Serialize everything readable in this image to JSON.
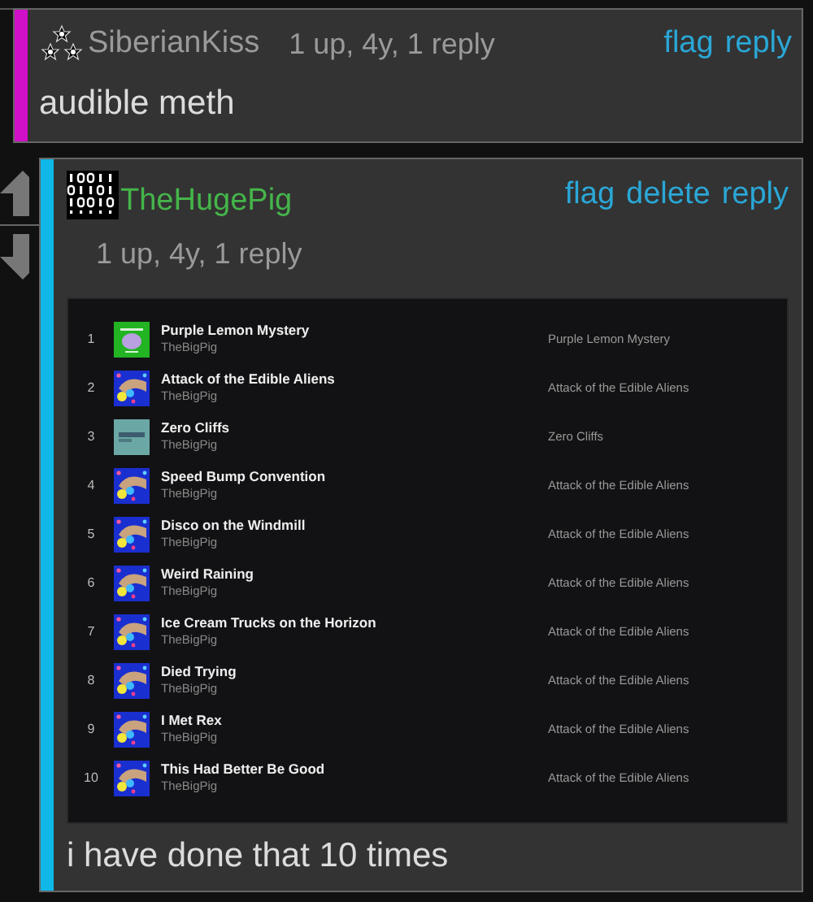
{
  "comment": {
    "author": "SiberianKiss",
    "meta": "1 up, 4y, 1 reply",
    "actions": [
      "flag",
      "reply"
    ],
    "text": "audible meth"
  },
  "reply": {
    "author": "TheHugePig",
    "meta": "1 up, 4y, 1 reply",
    "actions": [
      "flag",
      "delete",
      "reply"
    ],
    "text": "i have done that 10 times",
    "tracks": [
      {
        "number": "1",
        "title": "Purple Lemon Mystery",
        "artist": "TheBigPig",
        "album": "Purple Lemon Mystery",
        "kind": "planet"
      },
      {
        "number": "2",
        "title": "Attack of the Edible Aliens",
        "artist": "TheBigPig",
        "album": "Attack of the Edible Aliens",
        "kind": "alien"
      },
      {
        "number": "3",
        "title": "Zero Cliffs",
        "artist": "TheBigPig",
        "album": "Zero Cliffs",
        "kind": "cliffs"
      },
      {
        "number": "4",
        "title": "Speed Bump Convention",
        "artist": "TheBigPig",
        "album": "Attack of the Edible Aliens",
        "kind": "alien"
      },
      {
        "number": "5",
        "title": "Disco on the Windmill",
        "artist": "TheBigPig",
        "album": "Attack of the Edible Aliens",
        "kind": "alien"
      },
      {
        "number": "6",
        "title": "Weird Raining",
        "artist": "TheBigPig",
        "album": "Attack of the Edible Aliens",
        "kind": "alien"
      },
      {
        "number": "7",
        "title": "Ice Cream Trucks on the Horizon",
        "artist": "TheBigPig",
        "album": "Attack of the Edible Aliens",
        "kind": "alien"
      },
      {
        "number": "8",
        "title": "Died Trying",
        "artist": "TheBigPig",
        "album": "Attack of the Edible Aliens",
        "kind": "alien"
      },
      {
        "number": "9",
        "title": "I Met Rex",
        "artist": "TheBigPig",
        "album": "Attack of the Edible Aliens",
        "kind": "alien"
      },
      {
        "number": "10",
        "title": "This Had Better Be Good",
        "artist": "TheBigPig",
        "album": "Attack of the Edible Aliens",
        "kind": "alien"
      }
    ]
  }
}
